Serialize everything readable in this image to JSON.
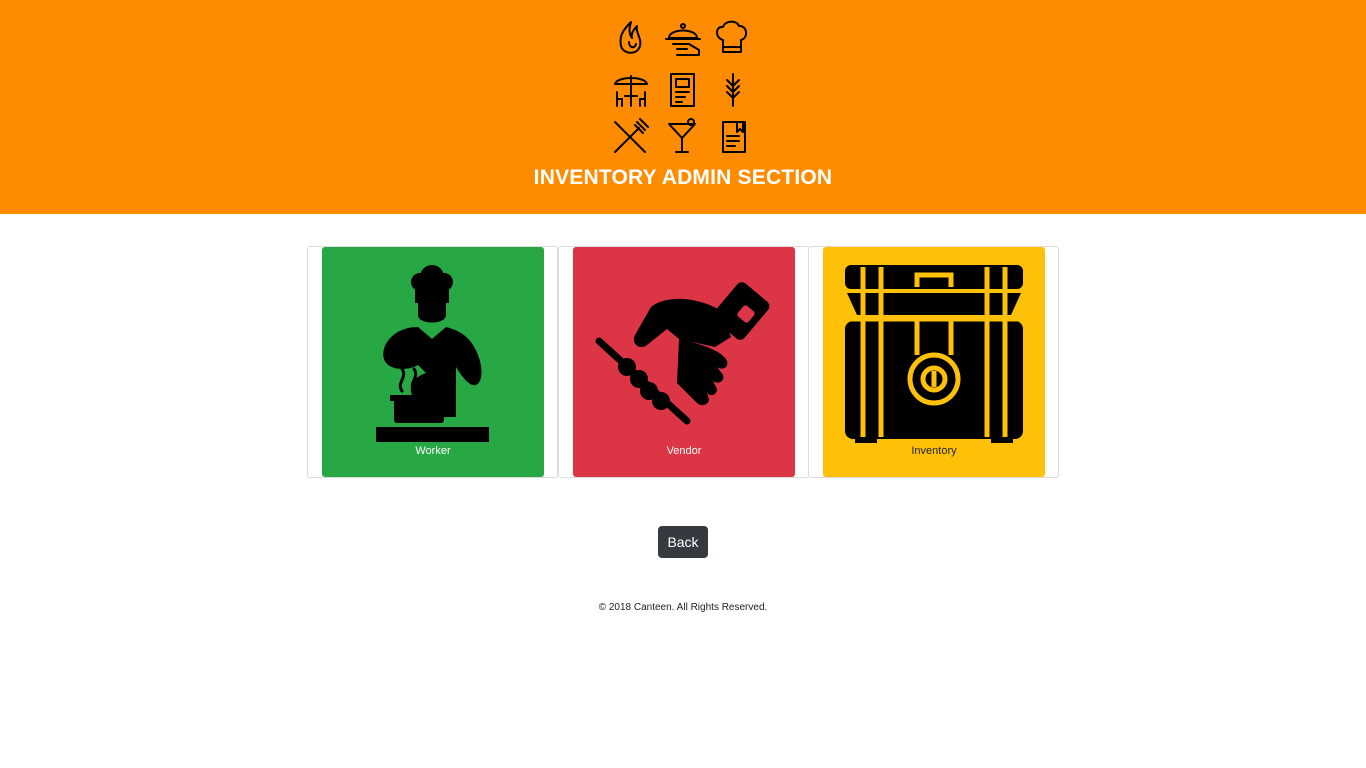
{
  "header": {
    "background": "#ff8c00",
    "title": "INVENTORY ADMIN SECTION",
    "logo_icons": [
      "flame-icon",
      "cloche-icon",
      "chef-hat-icon",
      "table-umbrella-icon",
      "menu-card-icon",
      "wheat-icon",
      "fork-knife-icon",
      "cocktail-icon",
      "menu-book-icon"
    ]
  },
  "cards": [
    {
      "label": "Worker",
      "color": "#28a745",
      "icon": "chef-cooking-icon"
    },
    {
      "label": "Vendor",
      "color": "#dc3545",
      "icon": "handshake-icon"
    },
    {
      "label": "Inventory",
      "color": "#ffc107",
      "icon": "treasure-chest-icon"
    }
  ],
  "back_button": {
    "label": "Back",
    "color": "#343a40"
  },
  "footer": {
    "text": "© 2018 Canteen. All Rights Reserved."
  }
}
